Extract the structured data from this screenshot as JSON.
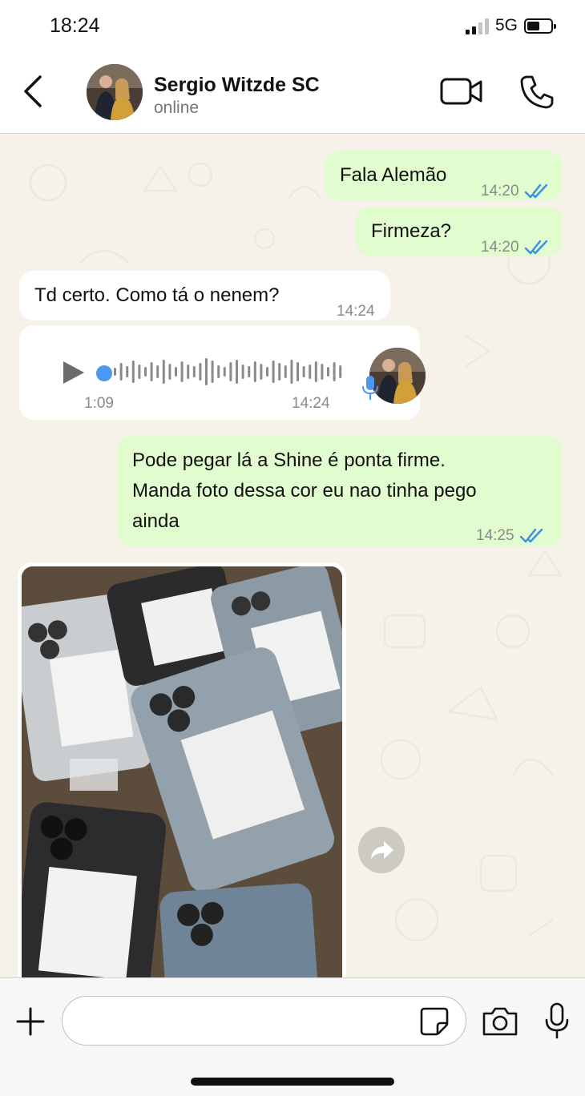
{
  "status_bar": {
    "time": "18:24",
    "network": "5G",
    "battery_icon": "battery-icon",
    "signal_icon": "signal-icon"
  },
  "header": {
    "contact_name": "Sergio Witzde SC",
    "contact_status": "online"
  },
  "messages": [
    {
      "direction": "out",
      "text": "Fala Alemão",
      "time": "14:20",
      "status": "read"
    },
    {
      "direction": "out",
      "text": "Firmeza?",
      "time": "14:20",
      "status": "read"
    },
    {
      "direction": "in",
      "text": "Td certo. Como tá o nenem?",
      "time": "14:24"
    },
    {
      "direction": "in",
      "type": "voice",
      "duration": "1:09",
      "time": "14:24"
    },
    {
      "direction": "out",
      "lines": [
        "Pode pegar lá a Shine é ponta firme.",
        "Manda foto dessa cor eu nao tinha pego",
        "ainda"
      ],
      "time": "14:25",
      "status": "read"
    },
    {
      "direction": "in",
      "type": "image",
      "subject": "boxed phones"
    }
  ],
  "colors": {
    "outgoing_bubble": "#e1fccf",
    "incoming_bubble": "#ffffff",
    "read_ticks": "#3b8fe6",
    "chat_background": "#f6f2ea"
  }
}
